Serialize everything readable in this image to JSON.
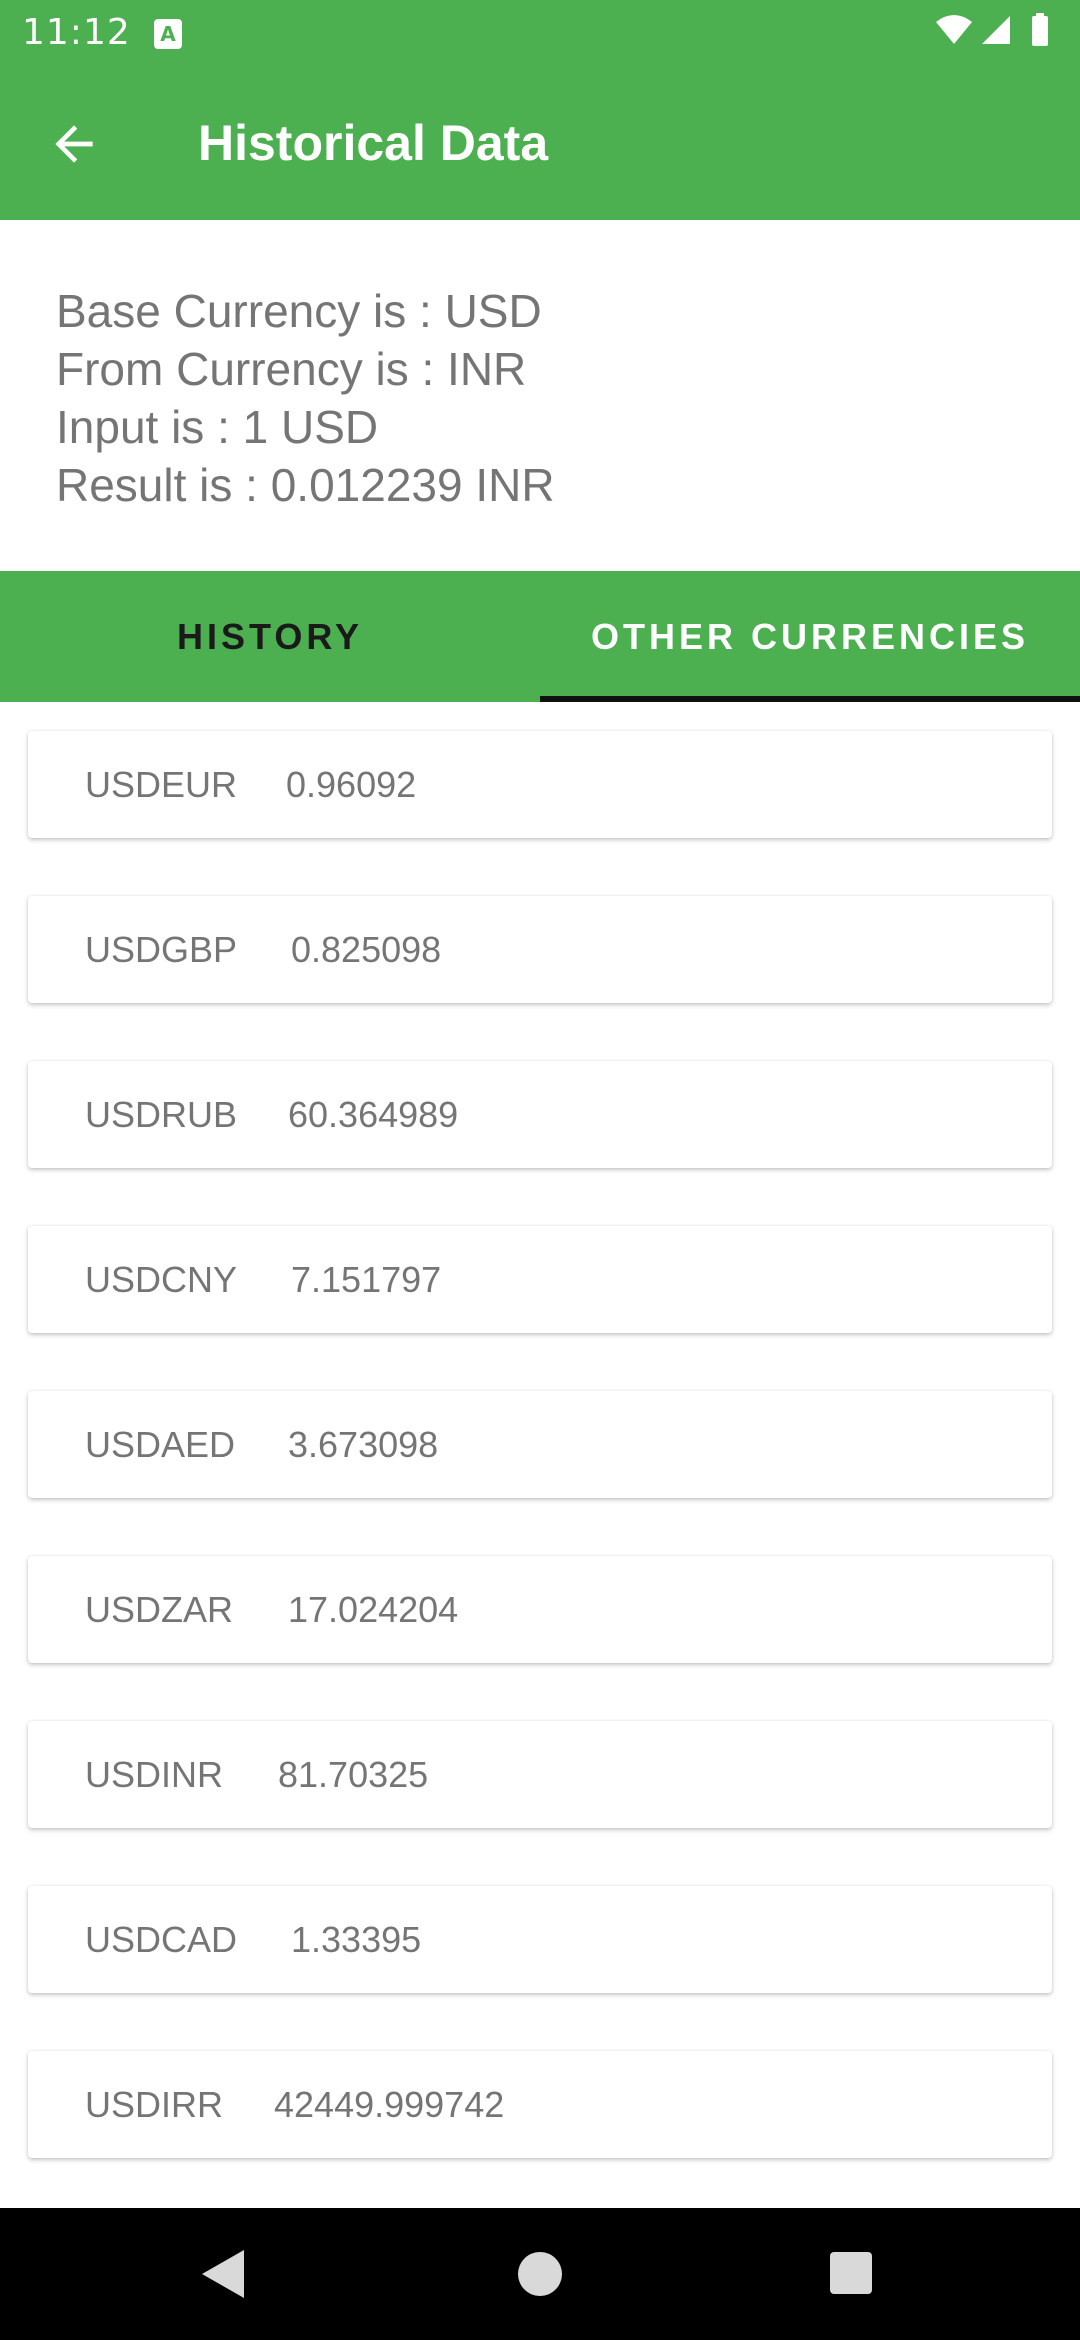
{
  "status_bar": {
    "time": "11:12",
    "notification_icon": "a-icon",
    "icons": [
      "wifi-icon",
      "signal-icon",
      "battery-icon"
    ]
  },
  "app_bar": {
    "title": "Historical Data",
    "back_icon": "arrow-left-icon"
  },
  "info": {
    "base_currency": "Base Currency is : USD",
    "from_currency": "From Currency is : INR",
    "input": "Input is : 1 USD",
    "result": "Result is : 0.012239 INR"
  },
  "tabs": [
    {
      "label": "HISTORY",
      "selected": false
    },
    {
      "label": "OTHER CURRENCIES",
      "selected": true
    }
  ],
  "rates": [
    {
      "pair": "USDEUR",
      "value": "0.96092"
    },
    {
      "pair": "USDGBP",
      "value": "0.825098"
    },
    {
      "pair": "USDRUB",
      "value": "60.364989"
    },
    {
      "pair": "USDCNY",
      "value": "7.151797"
    },
    {
      "pair": "USDAED",
      "value": "3.673098"
    },
    {
      "pair": "USDZAR",
      "value": "17.024204"
    },
    {
      "pair": "USDINR",
      "value": "81.70325"
    },
    {
      "pair": "USDCAD",
      "value": "1.33395"
    },
    {
      "pair": "USDIRR",
      "value": "42449.999742"
    }
  ],
  "colors": {
    "primary": "#4caf50",
    "text_secondary": "#757575",
    "tab_indicator": "#111111"
  }
}
